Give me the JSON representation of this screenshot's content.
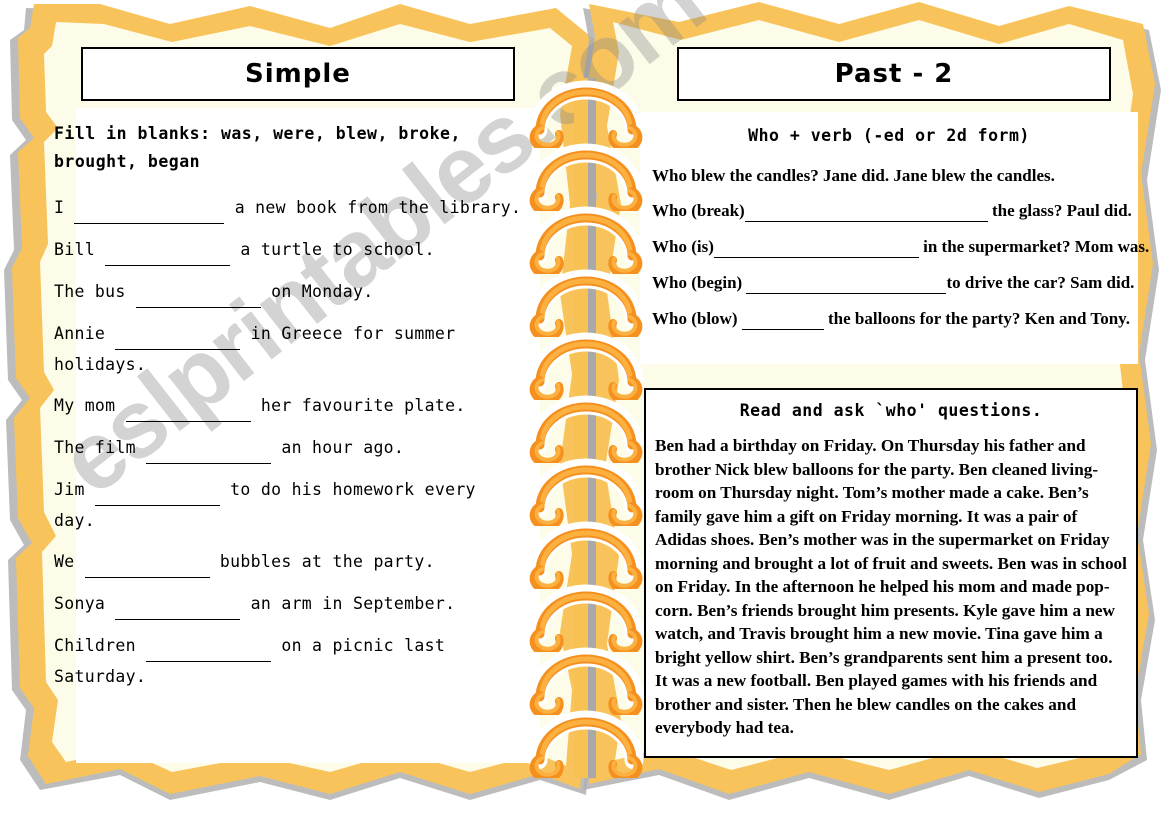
{
  "worksheet": {
    "left_title": "Simple",
    "right_title": "Past - 2",
    "watermark": "eslprintables.com",
    "colors": {
      "page_cream": "#fdfce8",
      "torn_orange": "#f8c35a",
      "shadow_gray": "#b0b0b0",
      "spiral_orange": "#f39325",
      "spiral_light": "#f9b455",
      "text_black": "#000000"
    }
  },
  "left_column": {
    "instruction": "Fill  in  blanks:  was,  were,  blew, broke, brought, began",
    "sentences": [
      {
        "before": "I ",
        "blank_width": 150,
        "after": " a new book from the library."
      },
      {
        "before": "Bill ",
        "blank_width": 125,
        "after": " a turtle to school."
      },
      {
        "before": "The bus ",
        "blank_width": 125,
        "after": " on Monday."
      },
      {
        "before": "Annie ",
        "blank_width": 125,
        "after": " in Greece for summer holidays."
      },
      {
        "before": "My  mom  ",
        "blank_width": 125,
        "after": "  her  favourite plate."
      },
      {
        "before": "The film ",
        "blank_width": 125,
        "after": " an hour ago."
      },
      {
        "before": "Jim ",
        "blank_width": 125,
        "after": "  to do his homework every day."
      },
      {
        "before": "We ",
        "blank_width": 125,
        "after": " bubbles at the party."
      },
      {
        "before": "Sonya ",
        "blank_width": 125,
        "after": "  an arm in September."
      },
      {
        "before": "Children ",
        "blank_width": 125,
        "after": " on  a picnic last Saturday."
      }
    ]
  },
  "right_column": {
    "heading": "Who + verb (-ed or 2d form)",
    "example": {
      "p1": "Who ",
      "b1": "blew",
      "p2": " the candles? Jane ",
      "b2": "did",
      "p3": ". Jane ",
      "b3": "blew",
      "p4": " the candles."
    },
    "questions": [
      {
        "before": "Who (break)",
        "blank_width": 243,
        "after": " the glass? Paul did."
      },
      {
        "before": "Who (is)",
        "blank_width": 205,
        "after": " in the supermarket? Mom was."
      },
      {
        "before": "Who (begin) ",
        "blank_width": 200,
        "after": "to drive the car? Sam did."
      },
      {
        "before": "Who (blow) ",
        "blank_width": 82,
        "after": " the balloons for the party? Ken and Tony."
      }
    ],
    "reading": {
      "title": "Read and ask `who' questions.",
      "body": "Ben had a birthday on Friday. On Thursday his father and brother Nick blew balloons for the party. Ben cleaned living-room on Thursday night. Tom’s mother made a cake. Ben’s family gave him a gift on Friday morning. It was a pair of Adidas shoes. Ben’s mother was in the supermarket on Friday morning and brought a lot of fruit and sweets. Ben was in school on Friday. In the afternoon he helped his mom and made pop-corn. Ben’s friends brought him presents. Kyle gave him a new watch, and Travis brought him a new movie. Tina gave him a bright yellow shirt. Ben’s grandparents sent him a present too. It was a new football. Ben played games with his friends and brother and sister. Then he blew candles on the cakes and everybody had tea."
    }
  },
  "spiral": {
    "ring_count": 11,
    "icon": "spiral-ring-icon"
  }
}
